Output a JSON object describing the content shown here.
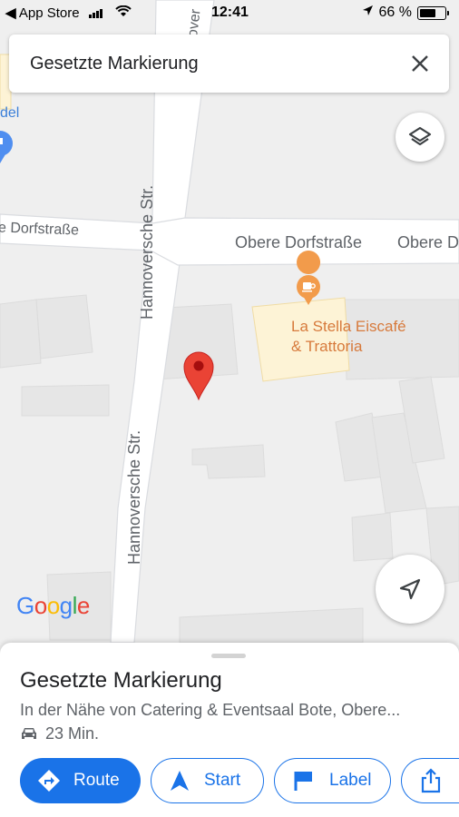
{
  "status_bar": {
    "back_label": "App Store",
    "time": "12:41",
    "battery_percent": "66 %",
    "battery_level": 0.66
  },
  "search": {
    "value": "Gesetzte Markierung"
  },
  "map": {
    "road_labels": {
      "hannoversche_upper": "Hannoversche Str.",
      "hannoversche_lower": "Hannoversche Str.",
      "obere_dorfstrasse": "Obere Dorfstraße",
      "obere_dorfstrasse_cut": "Obere D",
      "dorfstrasse_left": "e Dorfstraße",
      "top_partial": "over"
    },
    "poi": {
      "line1": "La Stella Eiscafé",
      "line2": "& Trattoria"
    },
    "edge_partial": "del",
    "attribution": {
      "g1": "G",
      "o1": "o",
      "o2": "o",
      "g2": "g",
      "l": "l",
      "e": "e"
    }
  },
  "colors": {
    "accent": "#1a73e8",
    "pin": "#ea4335",
    "poi": "#f29b4b"
  },
  "sheet": {
    "title": "Gesetzte Markierung",
    "subtitle": "In der Nähe von Catering & Eventsaal Bote, Obere...",
    "eta": "23 Min.",
    "buttons": {
      "route": "Route",
      "start": "Start",
      "label": "Label"
    }
  }
}
